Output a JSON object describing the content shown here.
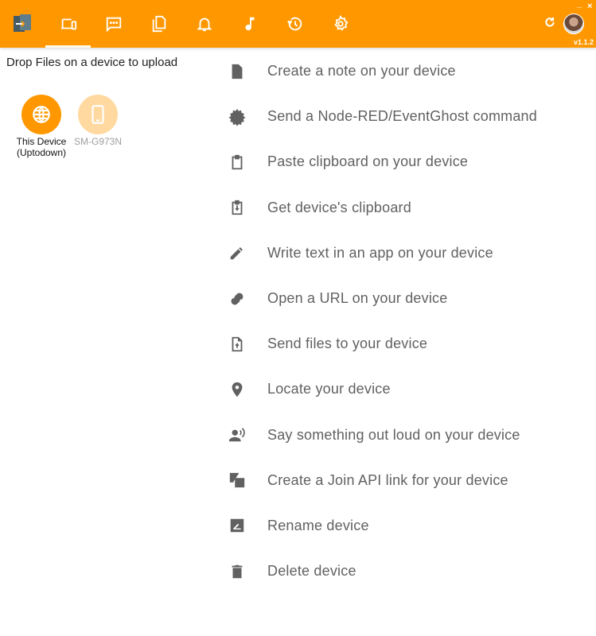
{
  "colors": {
    "accent": "#FF9800",
    "accent_light": "#FFD9A0",
    "icon_gray": "#616161"
  },
  "header": {
    "app_logo": "join-app-logo-icon",
    "tabs": [
      {
        "name": "devices",
        "icon": "devices-icon",
        "active": true
      },
      {
        "name": "sms",
        "icon": "sms-icon",
        "active": false
      },
      {
        "name": "clipboard-files",
        "icon": "files-icon",
        "active": false
      },
      {
        "name": "notifications",
        "icon": "bell-icon",
        "active": false
      },
      {
        "name": "media",
        "icon": "music-note-icon",
        "active": false
      },
      {
        "name": "history",
        "icon": "history-icon",
        "active": false
      },
      {
        "name": "settings",
        "icon": "gear-icon",
        "active": false
      }
    ],
    "refresh_icon": "refresh-icon",
    "minimize_label": "_",
    "close_label": "×",
    "version": "v1.1.2"
  },
  "devices_panel": {
    "drop_hint": "Drop Files on a device to upload",
    "devices": [
      {
        "name": "This Device\n(Uptodown)",
        "line1": "This Device",
        "line2": "(Uptodown)",
        "icon": "globe-icon",
        "selected": true
      },
      {
        "name": "SM-G973N",
        "line1": "SM-G973N",
        "line2": "",
        "icon": "phone-icon",
        "selected": false
      }
    ]
  },
  "actions": [
    {
      "label": "Create a note on your device",
      "icon": "note-icon"
    },
    {
      "label": "Send a Node-RED/EventGhost command",
      "icon": "command-gear-icon"
    },
    {
      "label": "Paste clipboard on your device",
      "icon": "clipboard-icon"
    },
    {
      "label": "Get device's clipboard",
      "icon": "clipboard-download-icon"
    },
    {
      "label": "Write text in an app on your device",
      "icon": "pencil-icon"
    },
    {
      "label": "Open a URL on your device",
      "icon": "link-icon"
    },
    {
      "label": "Send files to your device",
      "icon": "file-upload-icon"
    },
    {
      "label": "Locate your device",
      "icon": "location-pin-icon"
    },
    {
      "label": "Say something out loud on your device",
      "icon": "speak-icon"
    },
    {
      "label": "Create a Join API link for your device",
      "icon": "api-link-icon"
    },
    {
      "label": "Rename device",
      "icon": "rename-icon"
    },
    {
      "label": "Delete device",
      "icon": "trash-icon"
    }
  ]
}
